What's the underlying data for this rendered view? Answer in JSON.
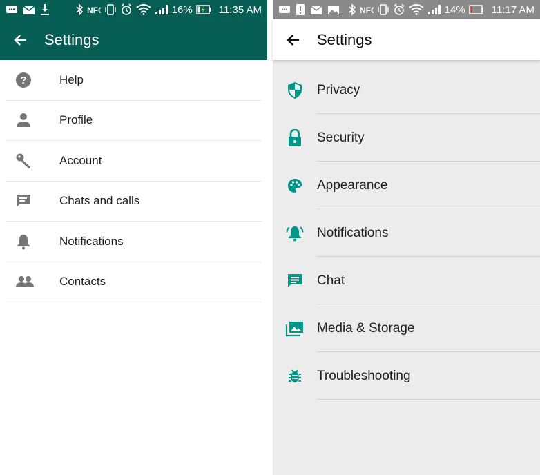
{
  "left": {
    "status": {
      "battery": "16%",
      "time": "11:35 AM"
    },
    "title": "Settings",
    "items": [
      {
        "label": "Help",
        "icon": "help-icon"
      },
      {
        "label": "Profile",
        "icon": "person-icon"
      },
      {
        "label": "Account",
        "icon": "key-icon"
      },
      {
        "label": "Chats and calls",
        "icon": "chat-icon"
      },
      {
        "label": "Notifications",
        "icon": "bell-icon"
      },
      {
        "label": "Contacts",
        "icon": "contacts-icon"
      }
    ]
  },
  "right": {
    "status": {
      "battery": "14%",
      "time": "11:17 AM"
    },
    "title": "Settings",
    "items": [
      {
        "label": "Privacy",
        "icon": "shield-icon"
      },
      {
        "label": "Security",
        "icon": "lock-icon"
      },
      {
        "label": "Appearance",
        "icon": "palette-icon"
      },
      {
        "label": "Notifications",
        "icon": "bell-ringing-icon"
      },
      {
        "label": "Chat",
        "icon": "chat-icon"
      },
      {
        "label": "Media & Storage",
        "icon": "media-icon"
      },
      {
        "label": "Troubleshooting",
        "icon": "bug-icon"
      }
    ]
  },
  "colors": {
    "whatsapp_green": "#075e54",
    "accent_teal": "#009688",
    "icon_gray": "#757575"
  }
}
